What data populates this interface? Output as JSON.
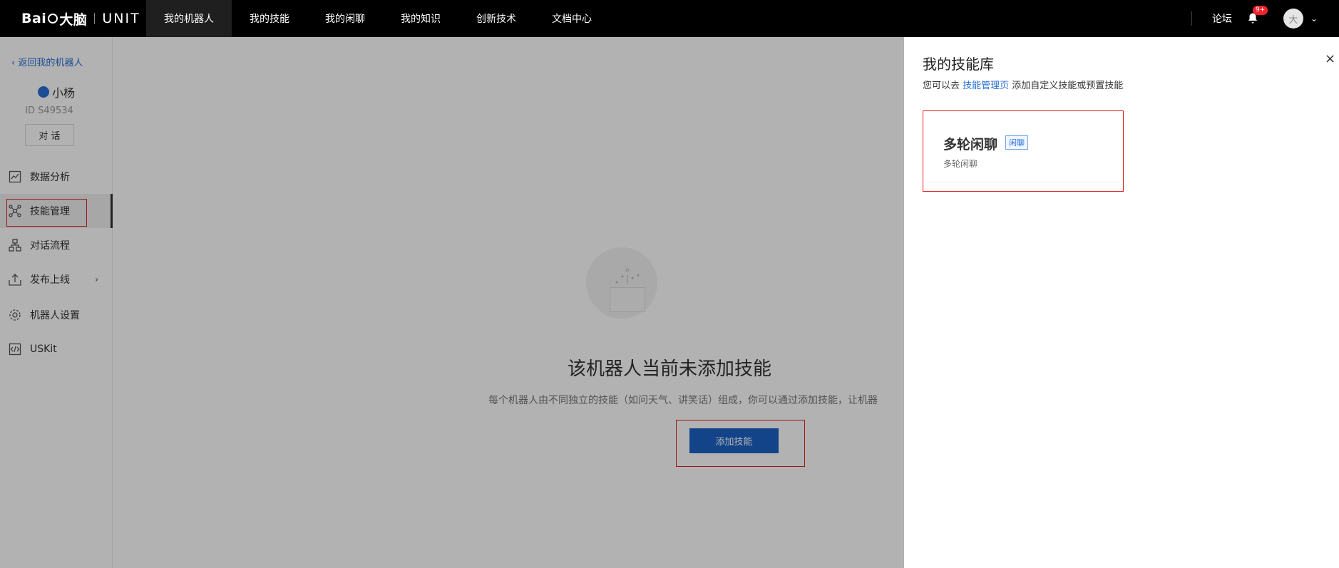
{
  "topbar": {
    "logo_text": "Bai",
    "logo_text2": "大脑",
    "logo_unit": "UNIT",
    "nav": [
      "我的机器人",
      "我的技能",
      "我的闲聊",
      "我的知识",
      "创新技术",
      "文档中心"
    ],
    "forum": "论坛",
    "badge": "9+",
    "avatar": "大",
    "dropdown_icon": "chevron-down-icon"
  },
  "sidebar": {
    "back": "返回我的机器人",
    "bot_name": "小杨",
    "bot_id": "ID S49534",
    "chat_button": "对 话",
    "items": [
      {
        "label": "数据分析",
        "icon": "chart-icon"
      },
      {
        "label": "技能管理",
        "icon": "skill-network-icon"
      },
      {
        "label": "对话流程",
        "icon": "flow-icon"
      },
      {
        "label": "发布上线",
        "icon": "upload-icon"
      },
      {
        "label": "机器人设置",
        "icon": "gear-icon"
      },
      {
        "label": "USKit",
        "icon": "code-icon"
      }
    ]
  },
  "main": {
    "empty_title": "该机器人当前未添加技能",
    "empty_desc": "每个机器人由不同独立的技能（如问天气、讲笑话）组成，你可以通过添加技能，让机器",
    "add_button": "添加技能"
  },
  "drawer": {
    "title": "我的技能库",
    "sub_prefix": "您可以去 ",
    "sub_link": "技能管理页",
    "sub_suffix": " 添加自定义技能或预置技能",
    "close": "×",
    "skill": {
      "name": "多轮闲聊",
      "tag": "闲聊",
      "desc": "多轮闲聊"
    }
  },
  "colors": {
    "accent": "#1c62c6",
    "link": "#2a6fd6",
    "highlight_box": "#e02020"
  }
}
